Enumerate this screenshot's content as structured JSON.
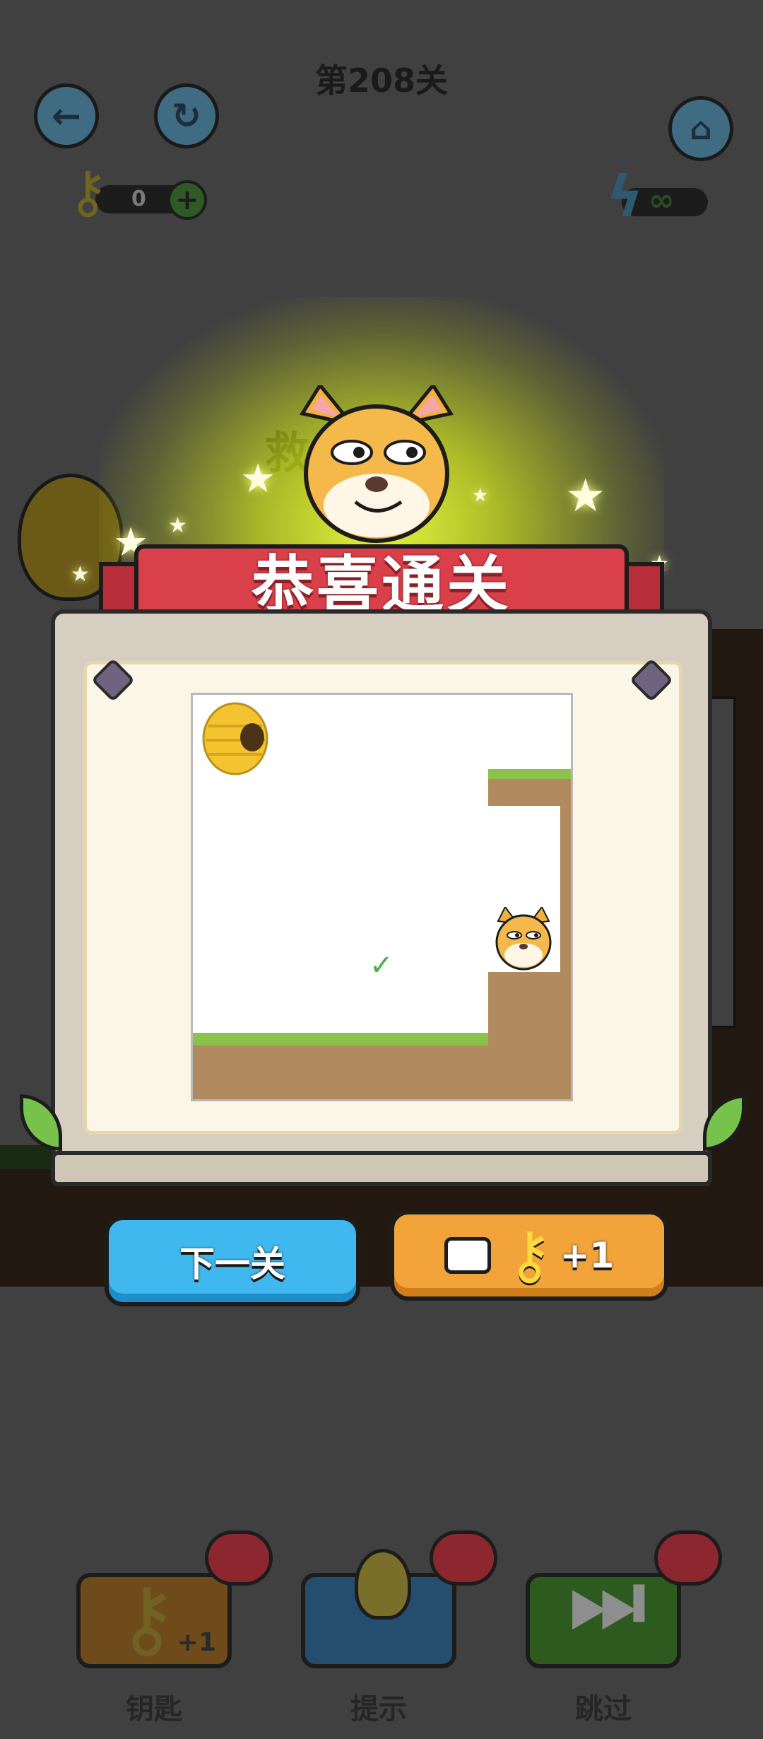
{
  "header": {
    "level_title": "第208关",
    "keys_count": "0"
  },
  "win_banner": {
    "title": "恭喜通关",
    "partial_text": "救"
  },
  "preview": {
    "completed_mark": "✓"
  },
  "actions": {
    "next_level": "下一关",
    "ad_key_reward": "+1"
  },
  "toolbar": {
    "key": {
      "label": "钥匙",
      "badge": "+1"
    },
    "hint": {
      "label": "提示"
    },
    "skip": {
      "label": "跳过"
    }
  },
  "icons": [
    "back-arrow-icon",
    "restart-icon",
    "home-icon",
    "key-icon",
    "plus-icon",
    "lightning-icon",
    "infinity-icon",
    "video-camera-icon",
    "lightbulb-icon",
    "skip-forward-icon",
    "beehive-icon",
    "shiba-dog-icon",
    "check-icon"
  ],
  "colors": {
    "ribbon": "#d9404a",
    "next_button": "#3fb8f0",
    "key_button": "#f2a33a",
    "glow": "#f0ff3c"
  }
}
